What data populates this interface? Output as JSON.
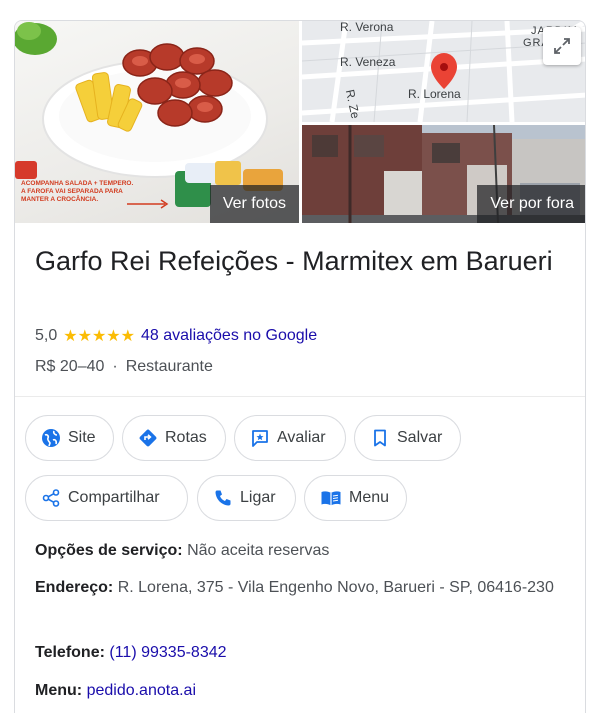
{
  "photos": {
    "food_label": "Ver fotos",
    "street_label": "Ver por fora",
    "promo_text": [
      "ACOMPANHA SALADA + TEMPERO.",
      "A FAROFA VAI SEPARADA PARA",
      "MANTER A CROCÂNCIA."
    ],
    "map_streets": [
      "R. Verona",
      "R. Veneza",
      "R. Lorena",
      "R. Ze",
      "JARDIM",
      "GRAZIE"
    ]
  },
  "business": {
    "name": "Garfo Rei Refeições - Marmitex em Barueri",
    "rating": "5,0",
    "stars": "★★★★★",
    "reviews_link": "48 avaliações no Google",
    "price": "R$ 20–40",
    "separator": "·",
    "category": "Restaurante"
  },
  "actions": {
    "site": "Site",
    "rotas": "Rotas",
    "avaliar": "Avaliar",
    "salvar": "Salvar",
    "compartilhar": "Compartilhar",
    "ligar": "Ligar",
    "menu": "Menu"
  },
  "info": {
    "service_label": "Opções de serviço:",
    "service_value": "Não aceita reservas",
    "address_label": "Endereço:",
    "address_value": "R. Lorena, 375 - Vila Engenho Novo, Barueri - SP, 06416-230",
    "phone_label": "Telefone:",
    "phone_value": "(11) 99335-8342",
    "menu_label": "Menu:",
    "menu_value": "pedido.anota.ai"
  },
  "colors": {
    "link": "#1a0dab",
    "star": "#fbbc04",
    "icon_blue": "#1a73e8",
    "map_pin": "#ea4335"
  }
}
